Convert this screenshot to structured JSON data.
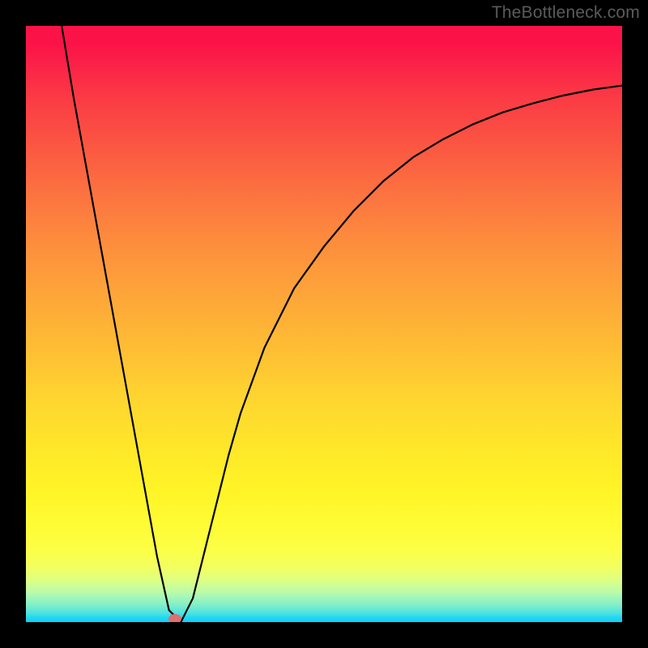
{
  "watermark": "TheBottleneck.com",
  "chart_data": {
    "type": "line",
    "title": "",
    "xlabel": "",
    "ylabel": "",
    "xlim": [
      0,
      100
    ],
    "ylim": [
      0,
      100
    ],
    "series": [
      {
        "name": "bottleneck-curve",
        "x": [
          6,
          8,
          10,
          12,
          14,
          16,
          18,
          20,
          22,
          24,
          26,
          28,
          30,
          32,
          34,
          36,
          40,
          45,
          50,
          55,
          60,
          65,
          70,
          75,
          80,
          85,
          90,
          95,
          100
        ],
        "values": [
          100,
          88,
          77,
          66,
          55,
          44,
          33,
          22,
          11,
          2,
          0,
          4,
          12,
          20,
          28,
          35,
          46,
          56,
          63,
          69,
          74,
          78,
          81,
          83.5,
          85.5,
          87,
          88.3,
          89.3,
          90
        ]
      }
    ],
    "minimum_point": {
      "x": 25,
      "y": 0
    },
    "background_gradient": {
      "top": "#fb1348",
      "upper_mid": "#fd8c3d",
      "mid": "#fed430",
      "lower_mid": "#fffb32",
      "bottom": "#0fcff9"
    }
  }
}
